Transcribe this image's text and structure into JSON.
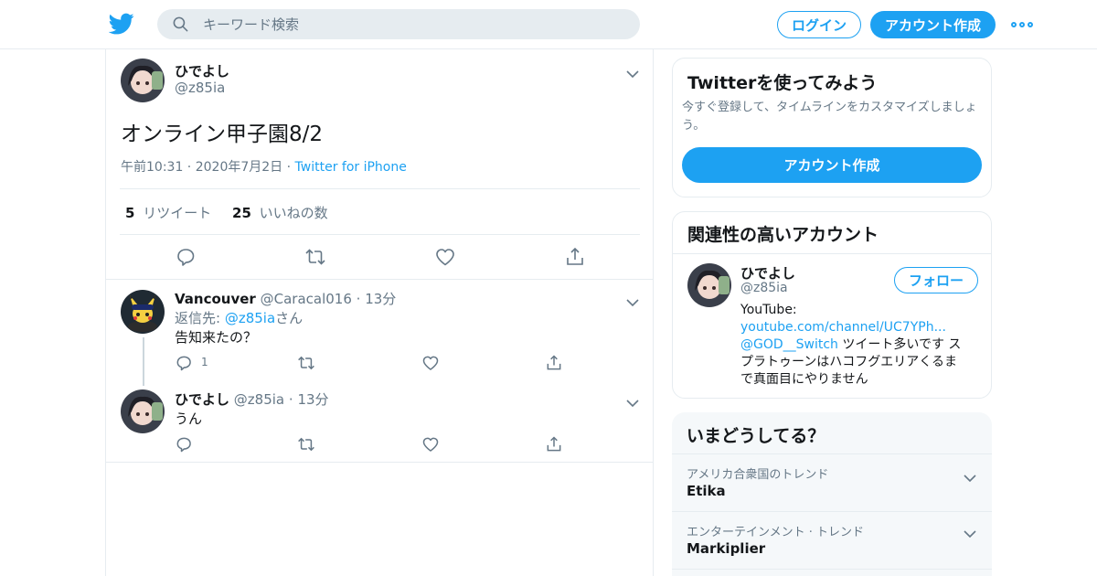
{
  "header": {
    "logo_icon": "twitter-bird-icon",
    "search_placeholder": "キーワード検索",
    "login_label": "ログイン",
    "signup_label": "アカウント作成",
    "more_icon": "more-dots-icon"
  },
  "tweet": {
    "display_name": "ひでよし",
    "handle": "@z85ia",
    "text": "オンライン甲子園8/2",
    "time": "午前10:31",
    "date": "2020年7月2日",
    "source": "Twitter for iPhone",
    "retweet_count": "5",
    "retweet_label": "リツイート",
    "like_count": "25",
    "like_label": "いいねの数"
  },
  "replies": [
    {
      "display_name": "Vancouver",
      "handle": "@Caracal016",
      "time": "13分",
      "reply_to_label": "返信先:",
      "reply_to_handle": "@z85ia",
      "reply_to_suffix": "さん",
      "text": "告知来たの？",
      "reply_count": "1"
    },
    {
      "display_name": "ひでよし",
      "handle": "@z85ia",
      "time": "13分",
      "text": "うん"
    }
  ],
  "signup_card": {
    "title": "Twitterを使ってみよう",
    "description": "今すぐ登録して、タイムラインをカスタマイズしましょう。",
    "button_label": "アカウント作成"
  },
  "related": {
    "title": "関連性の高いアカウント",
    "display_name": "ひでよし",
    "handle": "@z85ia",
    "follow_label": "フォロー",
    "bio_prefix": "YouTube:",
    "bio_link": "youtube.com/channel/UC7YPh...",
    "bio_mention": "@GOD__Switch",
    "bio_text_1": " ツイート多いです ス",
    "bio_text_2": "プラトゥーンはハコフグエリアくるま",
    "bio_text_3": "で真面目にやりません"
  },
  "trends": {
    "title": "いまどうしてる？",
    "items": [
      {
        "context": "アメリカ合衆国のトレンド",
        "name": "Etika"
      },
      {
        "context": "エンターテインメント · トレンド",
        "name": "Markiplier"
      }
    ]
  },
  "colors": {
    "accent": "#1da1f2",
    "text": "#14171a",
    "muted": "#657786",
    "border": "#e6ecf0",
    "panel": "#f5f8fa"
  }
}
